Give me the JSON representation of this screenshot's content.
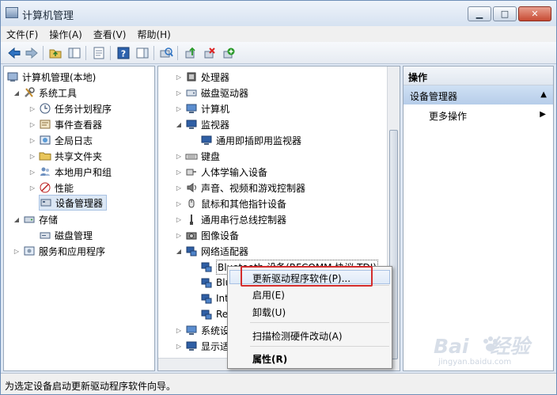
{
  "window": {
    "title": "计算机管理",
    "min": "▁",
    "max": "□",
    "close": "✕"
  },
  "menu": [
    "文件(F)",
    "操作(A)",
    "查看(V)",
    "帮助(H)"
  ],
  "left_tree": {
    "root": "计算机管理(本地)",
    "system_tools": "系统工具",
    "items": [
      "任务计划程序",
      "事件查看器",
      "全局日志",
      "共享文件夹",
      "本地用户和组",
      "性能",
      "设备管理器"
    ],
    "storage": "存储",
    "disk_management": "磁盘管理",
    "services": "服务和应用程序"
  },
  "device_tree": {
    "items": [
      "处理器",
      "磁盘驱动器",
      "计算机",
      "监视器",
      "通用即插即用监视器",
      "键盘",
      "人体学输入设备",
      "声音、视频和游戏控制器",
      "鼠标和其他指针设备",
      "通用串行总线控制器",
      "图像设备",
      "网络适配器"
    ],
    "network_children": [
      "Bluetooth 设备(RFCOMM 协议 TDI)",
      "Blu",
      "Int",
      "Re"
    ],
    "tail": [
      "系统设",
      "显示适"
    ]
  },
  "actions": {
    "header": "操作",
    "section": "设备管理器",
    "more": "更多操作"
  },
  "context_menu": {
    "update": "更新驱动程序软件(P)...",
    "enable": "启用(E)",
    "uninstall": "卸载(U)",
    "scan": "扫描检测硬件改动(A)",
    "properties": "属性(R)"
  },
  "status": "为选定设备启动更新驱动程序软件向导。",
  "watermark": {
    "main": "Bai",
    "suffix": "经验",
    "sub": "jingyan.baidu.com"
  }
}
